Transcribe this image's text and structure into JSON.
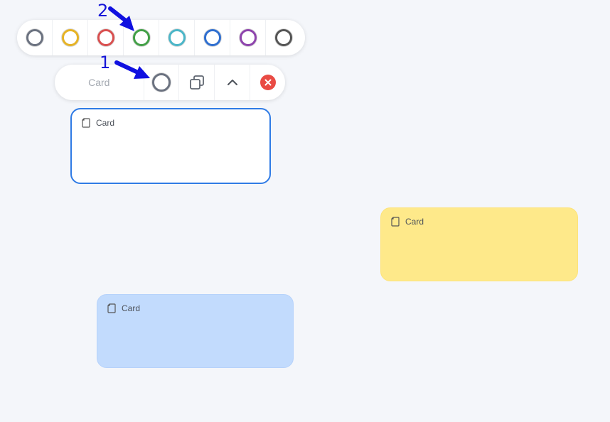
{
  "palette": {
    "swatches": [
      {
        "name": "gray",
        "color": "#6b7280"
      },
      {
        "name": "yellow",
        "color": "#e6b325"
      },
      {
        "name": "red",
        "color": "#d94f4f"
      },
      {
        "name": "green",
        "color": "#43a047"
      },
      {
        "name": "teal",
        "color": "#4bb6c8"
      },
      {
        "name": "blue",
        "color": "#2f6fd0"
      },
      {
        "name": "purple",
        "color": "#8e44ad"
      },
      {
        "name": "dark",
        "color": "#555555"
      }
    ]
  },
  "toolbar": {
    "label": "Card",
    "color_button_icon": "color-ring-icon",
    "duplicate_icon": "duplicate-icon",
    "collapse_icon": "chevron-up-icon",
    "close_icon": "close-icon"
  },
  "cards": [
    {
      "title": "Card",
      "color": "#ffffff",
      "selected": true
    },
    {
      "title": "Card",
      "color": "#fee98a",
      "selected": false
    },
    {
      "title": "Card",
      "color": "#c2dbfd",
      "selected": false
    }
  ],
  "annotations": [
    {
      "label": "1"
    },
    {
      "label": "2"
    }
  ]
}
